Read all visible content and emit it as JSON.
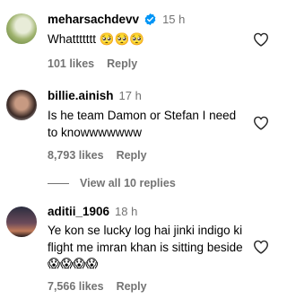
{
  "comments": [
    {
      "username": "meharsachdevv",
      "verified": true,
      "time": "15 h",
      "text": "Whattttttt 🥺🥺🥺",
      "likes": "101 likes",
      "reply": "Reply"
    },
    {
      "username": "billie.ainish",
      "verified": false,
      "time": "17 h",
      "text": "Is he team Damon or Stefan I need to knowwwwwww",
      "likes": "8,793 likes",
      "reply": "Reply"
    },
    {
      "username": "aditii_1906",
      "verified": false,
      "time": "18 h",
      "text": "Ye kon se lucky log hai jinki indigo ki flight me imran khan is sitting beside 😱😱😱😱",
      "likes": "7,566 likes",
      "reply": "Reply"
    }
  ],
  "view_all": {
    "label": "View all 10 replies"
  },
  "colors": {
    "secondary_text": "#737373",
    "verified_badge": "#0095f6"
  },
  "icons": {
    "verified": "verified-badge-icon",
    "like": "heart-outline-icon"
  }
}
